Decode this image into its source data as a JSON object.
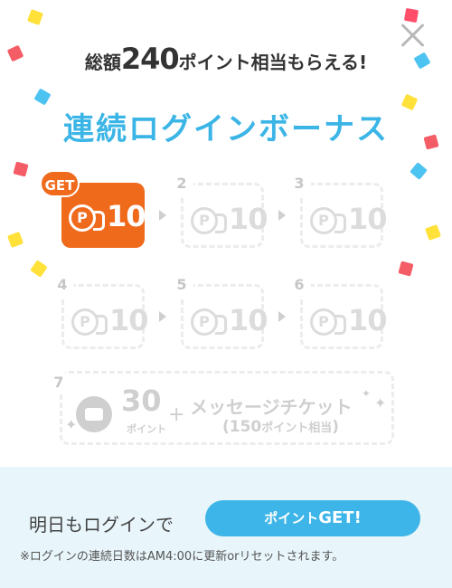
{
  "header": {
    "subtitle_pre": "総額",
    "subtitle_num": "240",
    "subtitle_post": "ポイント相当もらえる!",
    "title": "連続ログインボーナス"
  },
  "badge": "GET",
  "coin_letter": "P",
  "days": [
    {
      "day": "",
      "amount": "10"
    },
    {
      "day": "2",
      "amount": "10"
    },
    {
      "day": "3",
      "amount": "10"
    },
    {
      "day": "4",
      "amount": "10"
    },
    {
      "day": "5",
      "amount": "10"
    },
    {
      "day": "6",
      "amount": "10"
    }
  ],
  "day7": {
    "day": "7",
    "amount": "30",
    "unit": "ポイント",
    "plus": "+",
    "label": "メッセージチケット",
    "sub_pre": "(150",
    "sub_unit": "ポイント相当",
    "sub_post": ")"
  },
  "footer": {
    "message": "明日もログインで",
    "cta_small": "ポイント",
    "cta_big": "GET!",
    "note": "※ログインの連続日数はAM4:00に更新orリセットされます。"
  },
  "colors": {
    "accent_orange": "#f06a1c",
    "accent_blue": "#3db5e8",
    "title_blue": "#3bb5e6",
    "footer_bg": "#e8f5fb"
  },
  "icons": [
    "close-icon",
    "point-coin-icon",
    "ticket-icon",
    "sparkle-icon",
    "arrow-right-icon"
  ]
}
